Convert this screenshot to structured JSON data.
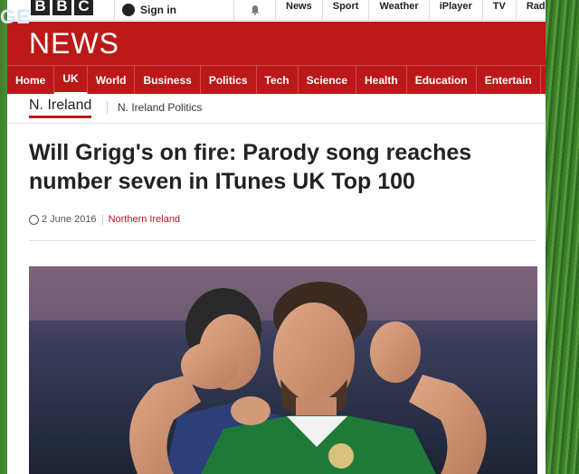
{
  "overlay_text": "GE",
  "topbar": {
    "brand_letters": [
      "B",
      "B",
      "C"
    ],
    "signin_label": "Sign in",
    "nav": [
      "News",
      "Sport",
      "Weather",
      "iPlayer",
      "TV",
      "Radio"
    ]
  },
  "news": {
    "title": "NEWS",
    "nav": [
      "Home",
      "UK",
      "World",
      "Business",
      "Politics",
      "Tech",
      "Science",
      "Health",
      "Education",
      "Entertain"
    ],
    "active_nav": "UK"
  },
  "subnav": {
    "primary": "N. Ireland",
    "secondary": "N. Ireland Politics"
  },
  "article": {
    "headline": "Will Grigg's on fire: Parody song reaches number seven in ITunes UK Top 100",
    "date": "2 June 2016",
    "section": "Northern Ireland"
  },
  "colors": {
    "brand_red": "#bb1919",
    "kit_green": "#1f7a3a",
    "kit_navy": "#1b2b63"
  }
}
